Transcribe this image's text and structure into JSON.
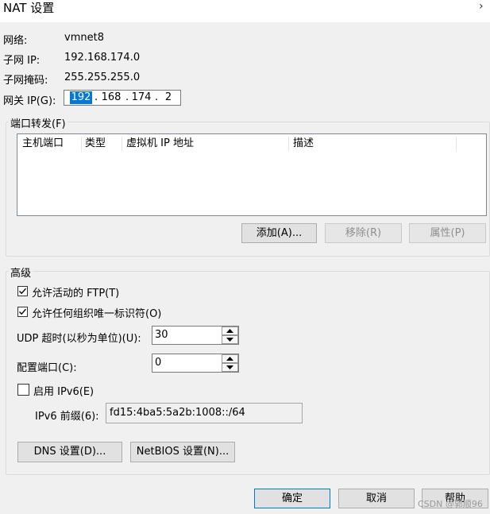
{
  "window": {
    "title": "NAT 设置",
    "close_glyph": "›"
  },
  "info": {
    "network_label": "网络:",
    "network_value": "vmnet8",
    "subnet_ip_label": "子网 IP:",
    "subnet_ip_value": "192.168.174.0",
    "subnet_mask_label": "子网掩码:",
    "subnet_mask_value": "255.255.255.0",
    "gateway_label": "网关 IP(G):",
    "gateway_octets": [
      "192",
      "168",
      "174",
      "2"
    ]
  },
  "port_forwarding": {
    "legend": "端口转发(F)",
    "columns": [
      "主机端口",
      "类型",
      "虚拟机 IP 地址",
      "描述"
    ],
    "add_button": "添加(A)...",
    "remove_button": "移除(R)",
    "properties_button": "属性(P)"
  },
  "advanced": {
    "legend": "高级",
    "allow_ftp": {
      "label": "允许活动的 FTP(T)",
      "checked": true
    },
    "allow_oui": {
      "label": "允许任何组织唯一标识符(O)",
      "checked": true
    },
    "udp_timeout_label": "UDP 超时(以秒为单位)(U):",
    "udp_timeout_value": "30",
    "config_port_label": "配置端口(C):",
    "config_port_value": "0",
    "enable_ipv6": {
      "label": "启用 IPv6(E)",
      "checked": false
    },
    "ipv6_prefix_label": "IPv6 前缀(6):",
    "ipv6_prefix_value": "fd15:4ba5:5a2b:1008::/64",
    "dns_button": "DNS 设置(D)...",
    "netbios_button": "NetBIOS 设置(N)..."
  },
  "footer": {
    "ok_button": "确定",
    "cancel_button": "取消",
    "help_button": "帮助",
    "watermark": "CSDN @郭顺96"
  }
}
